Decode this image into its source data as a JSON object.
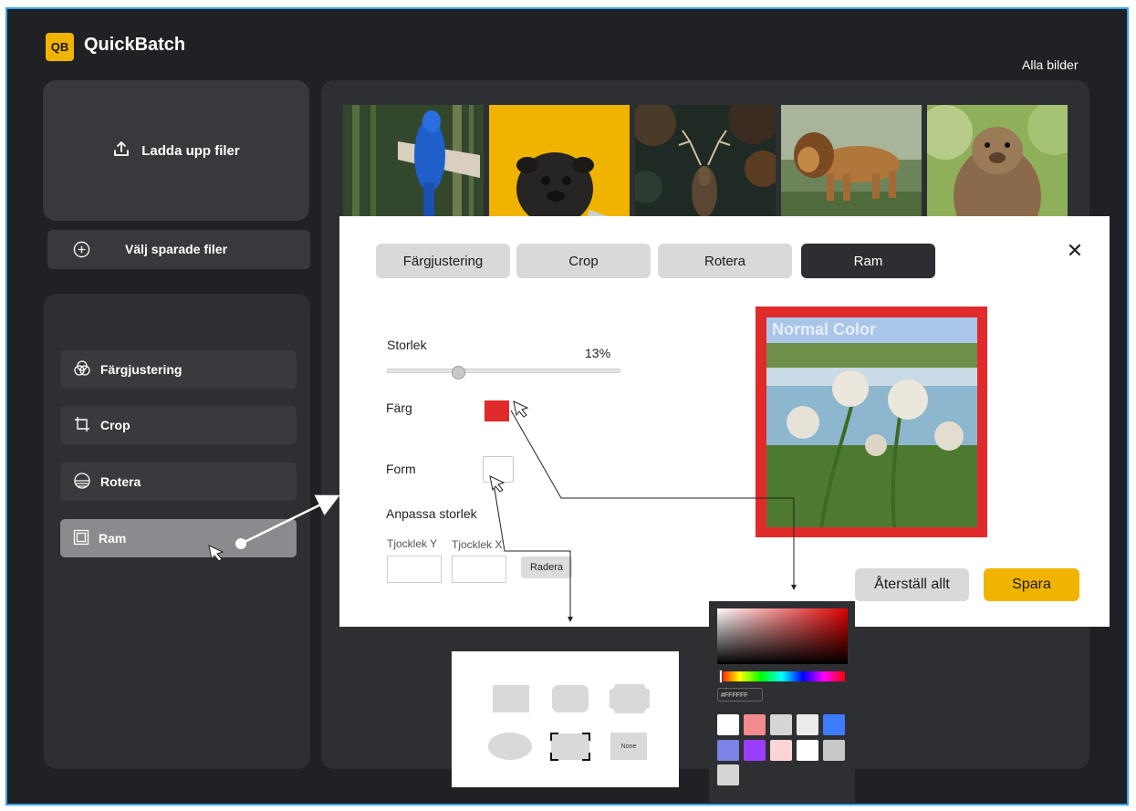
{
  "app": {
    "badge": "QB",
    "title": "QuickBatch"
  },
  "header": {
    "all_images_link": "Alla bilder"
  },
  "sidebar": {
    "upload_label": "Ladda upp filer",
    "saved_files_label": "Välj sparade filer",
    "tools": [
      {
        "label": "Färgjustering",
        "icon": "color-circles-icon"
      },
      {
        "label": "Crop",
        "icon": "crop-icon"
      },
      {
        "label": "Rotera",
        "icon": "rotate-icon"
      },
      {
        "label": "Ram",
        "icon": "frame-icon",
        "active": true
      }
    ]
  },
  "gallery": {
    "thumbnails": [
      {
        "subject": "blue parrot"
      },
      {
        "subject": "pug on yellow"
      },
      {
        "subject": "deer in forest"
      },
      {
        "subject": "walking lion"
      },
      {
        "subject": "marmot"
      }
    ]
  },
  "modal": {
    "tabs": [
      "Färgjustering",
      "Crop",
      "Rotera",
      "Ram"
    ],
    "active_tab": "Ram",
    "size_label": "Storlek",
    "size_value": "13%",
    "size_fraction": 0.13,
    "color_label": "Färg",
    "border_color": "#e02b2b",
    "form_label": "Form",
    "custom_size_label": "Anpassa storlek",
    "thickness_y_label": "Tjocklek Y",
    "thickness_x_label": "Tjocklek X",
    "delete_button": "Radera",
    "preview_caption": "Normal Color",
    "reset_button": "Återställ allt",
    "save_button": "Spara"
  },
  "shape_popup": {
    "none_label": "None"
  },
  "color_picker": {
    "hex_value": "#FFFFFF",
    "swatches": [
      "#ffffff",
      "#f28b8b",
      "#d6d6d6",
      "#ececec",
      "#3d7bff",
      "#7b83e6",
      "#9b3dff",
      "#fbd5d5",
      "#ffffff",
      "#c8c8c8",
      "#d6d6d6"
    ]
  },
  "colors": {
    "accent": "#f0b400",
    "background": "#202125",
    "panel": "#2e2f33"
  }
}
